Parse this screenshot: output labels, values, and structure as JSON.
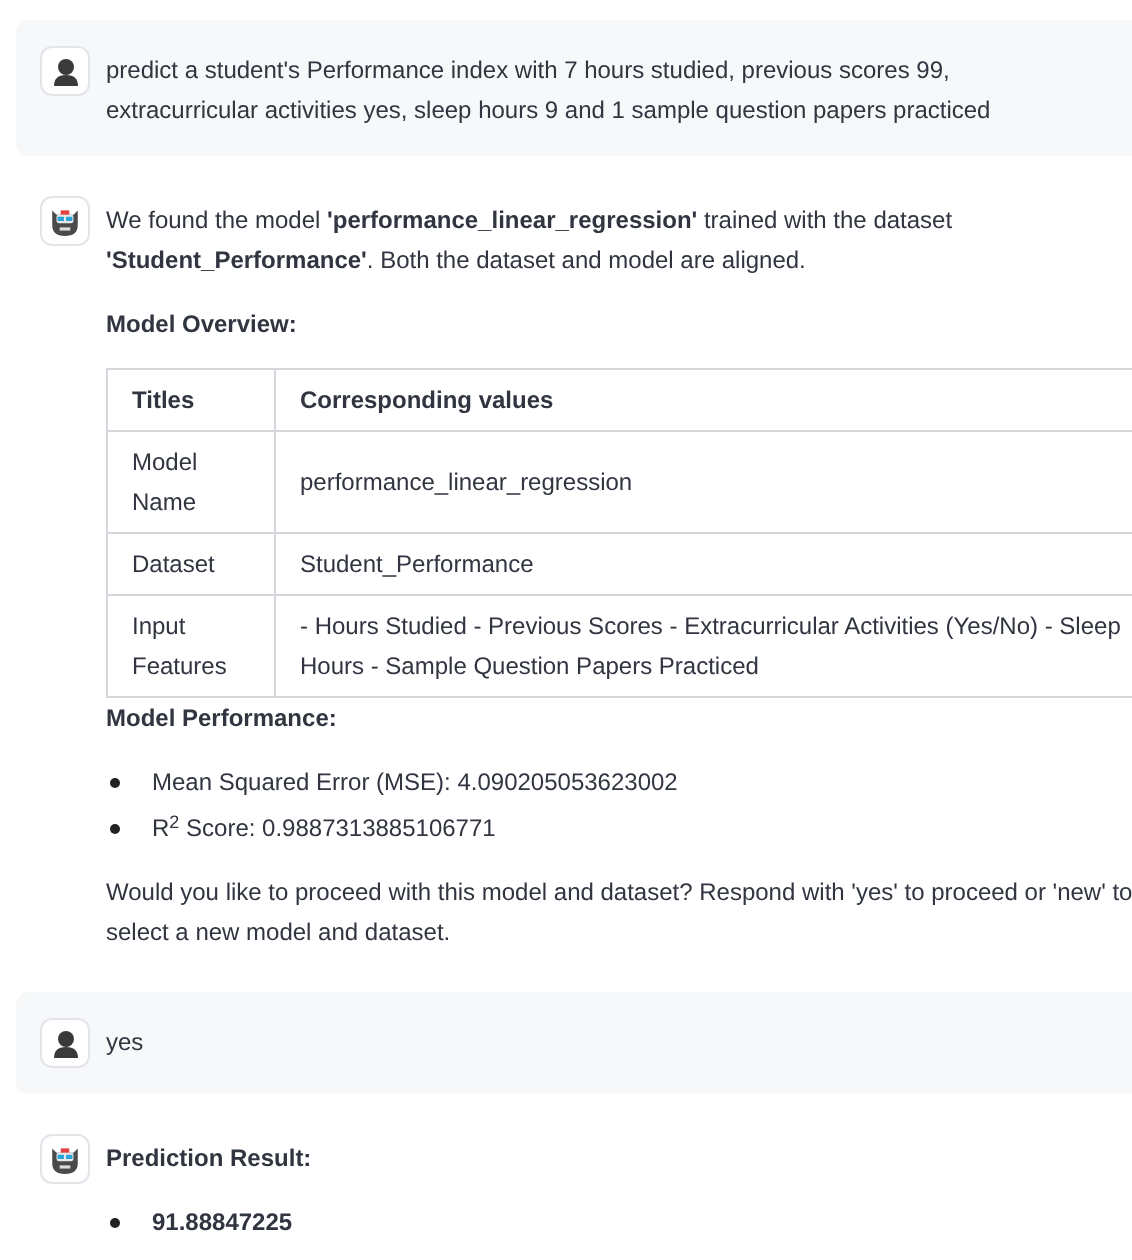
{
  "messages": [
    {
      "kind": "user",
      "text": "predict a student's Performance index with 7 hours studied, previous scores 99, extracurricular activities yes, sleep hours 9 and 1 sample question papers practiced"
    },
    {
      "kind": "assistant",
      "blocks": [
        {
          "kind": "paragraph",
          "text": "We found the model **'performance_linear_regression'** trained with the dataset **'Student_Performance'**. Both the dataset and model are aligned."
        },
        {
          "kind": "heading",
          "text": "Model Overview:"
        },
        {
          "kind": "table",
          "columns": [
            "Titles",
            "Corresponding values"
          ],
          "rows": [
            [
              "Model Name",
              "performance_linear_regression"
            ],
            [
              "Dataset",
              "Student_Performance"
            ],
            [
              "Input Features",
              "- Hours Studied - Previous Scores - Extracurricular Activities (Yes/No) - Sleep Hours - Sample Question Papers Practiced"
            ]
          ]
        },
        {
          "kind": "heading",
          "text": "Model Performance:"
        },
        {
          "kind": "list",
          "bold": false,
          "items": [
            "Mean Squared Error (MSE): 4.090205053623002",
            "R$^{2}$ Score: 0.9887313885106771"
          ]
        },
        {
          "kind": "paragraph",
          "text": "Would you like to proceed with this model and dataset? Respond with 'yes' to proceed or 'new' to select a new model and dataset."
        }
      ]
    },
    {
      "kind": "user",
      "text": "yes"
    },
    {
      "kind": "assistant",
      "blocks": [
        {
          "kind": "heading",
          "text": "Prediction Result:"
        },
        {
          "kind": "list",
          "bold": true,
          "items": [
            "91.88847225"
          ]
        }
      ]
    }
  ]
}
